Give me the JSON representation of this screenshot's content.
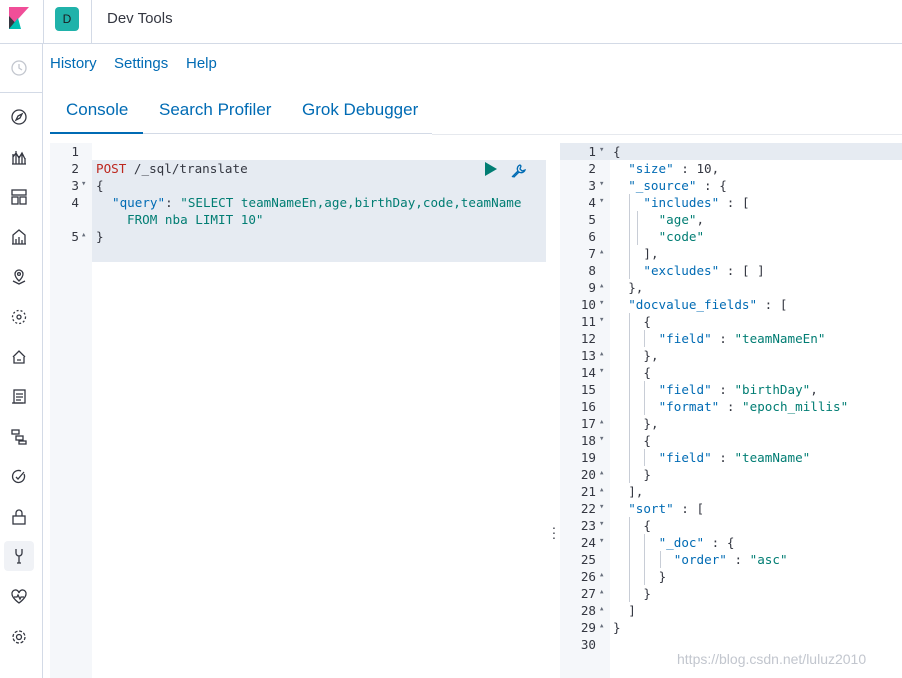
{
  "header": {
    "space_initial": "D",
    "app_title": "Dev Tools"
  },
  "nav_icons": [
    "clock-icon",
    "compass-icon",
    "chart-icon",
    "dashboard-icon",
    "canvas-icon",
    "maps-icon",
    "ml-icon",
    "infra-icon",
    "logs-icon",
    "apm-icon",
    "uptime-icon",
    "siem-icon",
    "devtools-icon",
    "monitoring-icon",
    "gear-icon"
  ],
  "top_links": [
    "History",
    "Settings",
    "Help"
  ],
  "tabs": [
    "Console",
    "Search Profiler",
    "Grok Debugger"
  ],
  "request": {
    "line_numbers": [
      "1",
      "2",
      "3",
      "4",
      "",
      "5"
    ],
    "method": "POST",
    "url": " /_sql/translate",
    "open_brace": "{",
    "query_key": "\"query\"",
    "query_colon": ": ",
    "query_value_1": "\"SELECT teamNameEn,age,birthDay,code,teamName",
    "query_value_2": "FROM nba LIMIT 10\"",
    "close_brace": "}"
  },
  "response": {
    "line_numbers": [
      "1",
      "2",
      "3",
      "4",
      "5",
      "6",
      "7",
      "8",
      "9",
      "10",
      "11",
      "12",
      "13",
      "14",
      "15",
      "16",
      "17",
      "18",
      "19",
      "20",
      "21",
      "22",
      "23",
      "24",
      "25",
      "26",
      "27",
      "28",
      "29",
      "30"
    ],
    "lines": [
      "{",
      "  \"size\" : 10,",
      "  \"_source\" : {",
      "    \"includes\" : [",
      "      \"age\",",
      "      \"code\"",
      "    ],",
      "    \"excludes\" : [ ]",
      "  },",
      "  \"docvalue_fields\" : [",
      "    {",
      "      \"field\" : \"teamNameEn\"",
      "    },",
      "    {",
      "      \"field\" : \"birthDay\",",
      "      \"format\" : \"epoch_millis\"",
      "    },",
      "    {",
      "      \"field\" : \"teamName\"",
      "    }",
      "  ],",
      "  \"sort\" : [",
      "    {",
      "      \"_doc\" : {",
      "        \"order\" : \"asc\"",
      "      }",
      "    }",
      "  ]",
      "}",
      ""
    ]
  },
  "watermark": "https://blog.csdn.net/luluz2010",
  "colors": {
    "link": "#006bb4",
    "method": "#bd271e",
    "string": "#017d73",
    "run_button": "#017d73",
    "space_avatar": "#20b2aa"
  }
}
